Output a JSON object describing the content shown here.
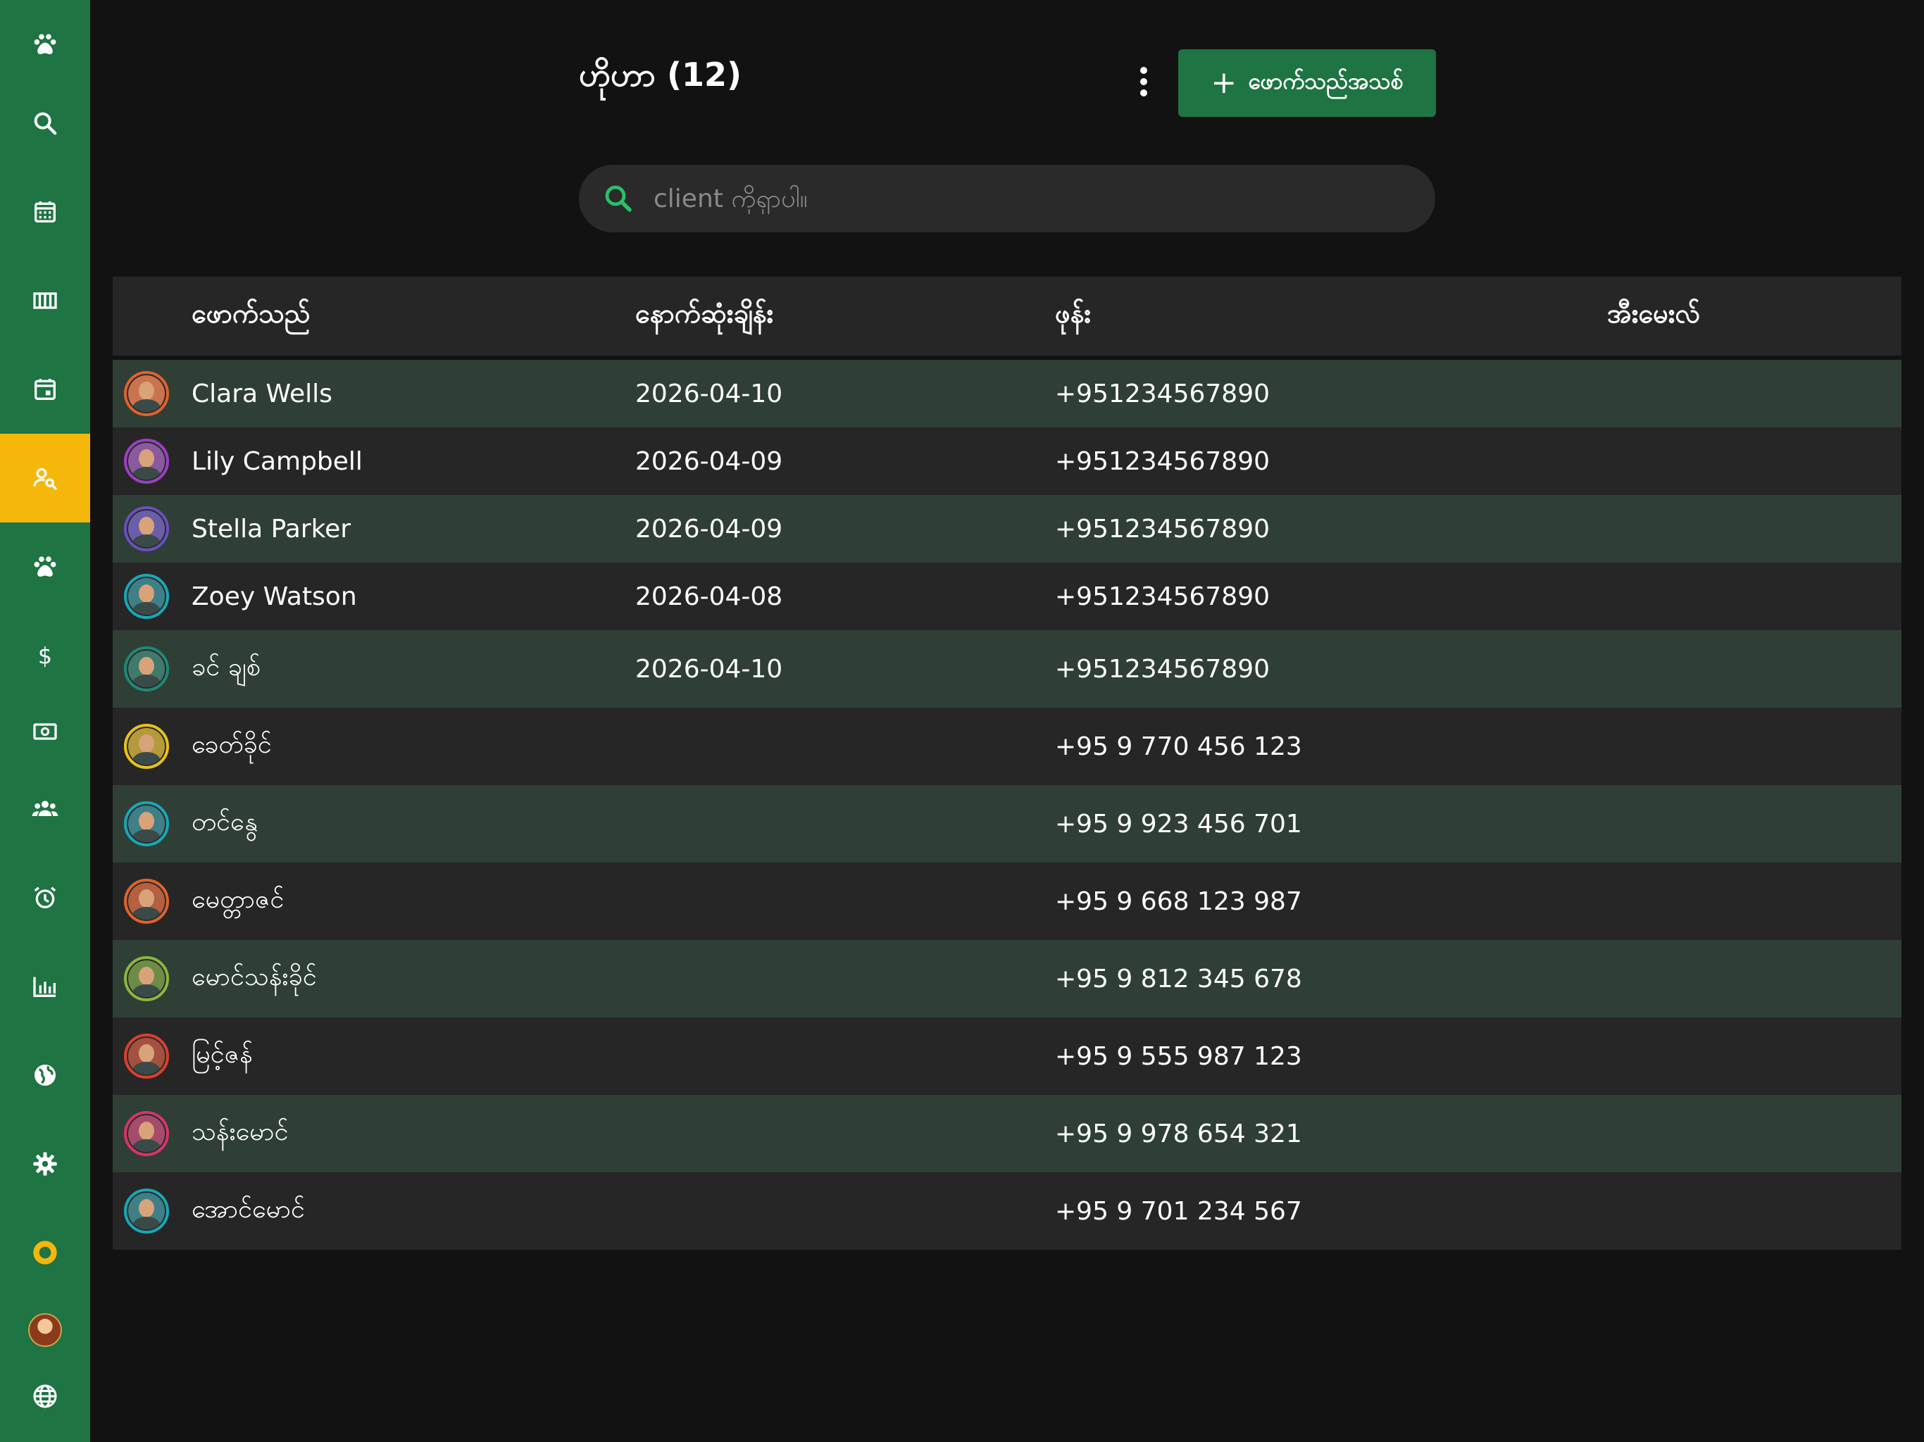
{
  "sidebar": {
    "items": [
      {
        "icon": "paw-icon",
        "active": false
      },
      {
        "icon": "search-icon",
        "active": false
      },
      {
        "icon": "calendar-grid-icon",
        "active": false
      },
      {
        "icon": "columns-icon",
        "active": false
      },
      {
        "icon": "calendar-event-icon",
        "active": false
      },
      {
        "icon": "person-search-icon",
        "active": true
      },
      {
        "icon": "paw-icon",
        "active": false
      },
      {
        "icon": "dollar-icon",
        "active": false
      },
      {
        "icon": "cash-icon",
        "active": false
      },
      {
        "icon": "group-icon",
        "active": false
      },
      {
        "icon": "alarm-icon",
        "active": false
      },
      {
        "icon": "bar-chart-icon",
        "active": false
      },
      {
        "icon": "globe-icon",
        "active": false
      },
      {
        "icon": "gear-icon",
        "active": false
      },
      {
        "icon": "ring-icon",
        "active": false
      },
      {
        "icon": "user-avatar",
        "active": false
      },
      {
        "icon": "language-icon",
        "active": false
      }
    ],
    "colors": {
      "background": "#1e7442",
      "active": "#f5b70a"
    }
  },
  "header": {
    "title": "ဟိုဟာ (12)",
    "more_icon": "more-vertical-icon",
    "add_button": {
      "plus": "+",
      "label": "ဖောက်သည်အသစ်"
    }
  },
  "search": {
    "placeholder": "client ကိုရှာပါ။",
    "value": ""
  },
  "table": {
    "columns": [
      "ဖောက်သည်",
      "နောက်ဆုံးချိန်း",
      "ဖုန်း",
      "အီးမေးလ်"
    ],
    "rows": [
      {
        "name": "Clara Wells",
        "date": "2026-04-10",
        "phone": "+951234567890",
        "email": "",
        "ring": "#e0622a",
        "bg": "#c9734f"
      },
      {
        "name": "Lily Campbell",
        "date": "2026-04-09",
        "phone": "+951234567890",
        "email": "",
        "ring": "#9b3fc4",
        "bg": "#8a5a9e"
      },
      {
        "name": "Stella Parker",
        "date": "2026-04-09",
        "phone": "+951234567890",
        "email": "",
        "ring": "#6a4fc0",
        "bg": "#6b5ea8"
      },
      {
        "name": "Zoey Watson",
        "date": "2026-04-08",
        "phone": "+951234567890",
        "email": "",
        "ring": "#18a7b5",
        "bg": "#3f7f88"
      },
      {
        "name": "ခင် ချစ်",
        "date": "2026-04-10",
        "phone": "+951234567890",
        "email": "",
        "ring": "#1c8a74",
        "bg": "#3f7a6c"
      },
      {
        "name": "ခေတ်ခိုင်",
        "date": "",
        "phone": "+95 9 770 456 123",
        "email": "",
        "ring": "#e8c21a",
        "bg": "#b59a3c"
      },
      {
        "name": "တင်နွေ",
        "date": "",
        "phone": "+95 9 923 456 701",
        "email": "",
        "ring": "#18a7b5",
        "bg": "#3f7f88"
      },
      {
        "name": "မေတ္တာဇင်",
        "date": "",
        "phone": "+95 9 668 123 987",
        "email": "",
        "ring": "#e0622a",
        "bg": "#b5603f"
      },
      {
        "name": "မောင်သန်းခိုင်",
        "date": "",
        "phone": "+95 9 812 345 678",
        "email": "",
        "ring": "#8bb73a",
        "bg": "#6d8c45"
      },
      {
        "name": "မြင့်ဇန်",
        "date": "",
        "phone": "+95 9 555 987 123",
        "email": "",
        "ring": "#d8402e",
        "bg": "#a5513f"
      },
      {
        "name": "သန်းမောင်",
        "date": "",
        "phone": "+95 9 978 654 321",
        "email": "",
        "ring": "#d8336a",
        "bg": "#a44d6a"
      },
      {
        "name": "အောင်မောင်",
        "date": "",
        "phone": "+95 9 701 234 567",
        "email": "",
        "ring": "#18a7b5",
        "bg": "#3f7f88"
      }
    ]
  },
  "colors": {
    "page_bg": "#121212",
    "accent_green": "#1e7442",
    "active_yellow": "#f5b70a",
    "row_green": "#2f3f36",
    "row_dark": "#262626",
    "search_icon": "#2bbf6a"
  }
}
